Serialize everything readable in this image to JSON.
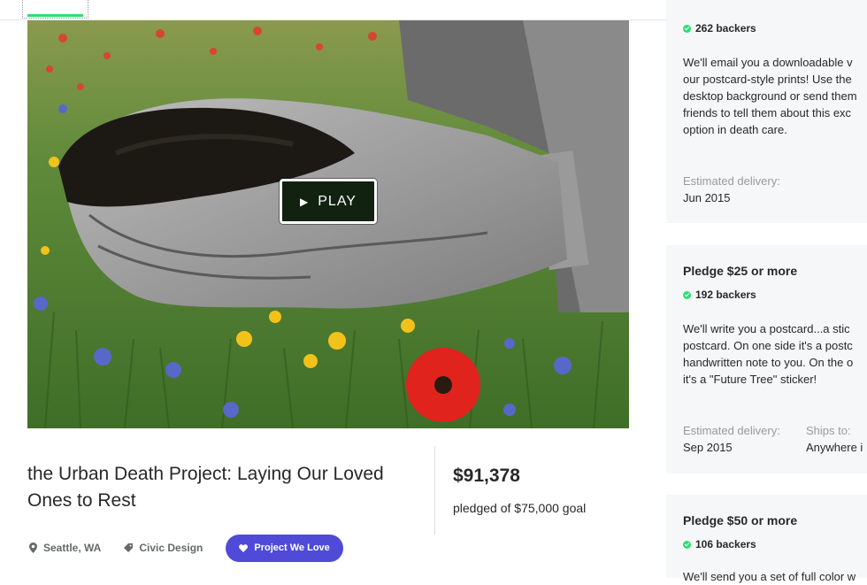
{
  "project": {
    "title_line1": "the Urban Death Project: Laying Our Loved",
    "title_line2": "Ones to Rest",
    "pledged_amount": "$91,378",
    "goal_text": "pledged of $75,000 goal",
    "location": "Seattle, WA",
    "category": "Civic Design",
    "badge": "Project We Love"
  },
  "video": {
    "play_label": "PLAY",
    "play_icon": "play-icon"
  },
  "colors": {
    "accent_green": "#2bde73",
    "badge_purple": "#4f4bd8",
    "card_bg": "#f6f7f8",
    "play_bg": "#112211"
  },
  "rewards": [
    {
      "backers": "262 backers",
      "description": [
        "We'll email you a downloadable v",
        "our postcard-style prints! Use the",
        "desktop background or send them",
        "friends to tell them about this exc",
        "option in death care."
      ],
      "delivery_label": "Estimated delivery:",
      "delivery_value": "Jun 2015"
    },
    {
      "title": "Pledge $25 or more",
      "backers": "192 backers",
      "description": [
        "We'll write you a postcard...a stic",
        "postcard. On one side it's a postc",
        "handwritten note to you. On the o",
        "it's a \"Future Tree\" sticker!"
      ],
      "delivery_label": "Estimated delivery:",
      "delivery_value": "Sep 2015",
      "ships_label": "Ships to:",
      "ships_value": "Anywhere i"
    },
    {
      "title": "Pledge $50 or more",
      "backers": "106 backers",
      "description": [
        "We'll send you a set of full color w"
      ]
    }
  ]
}
